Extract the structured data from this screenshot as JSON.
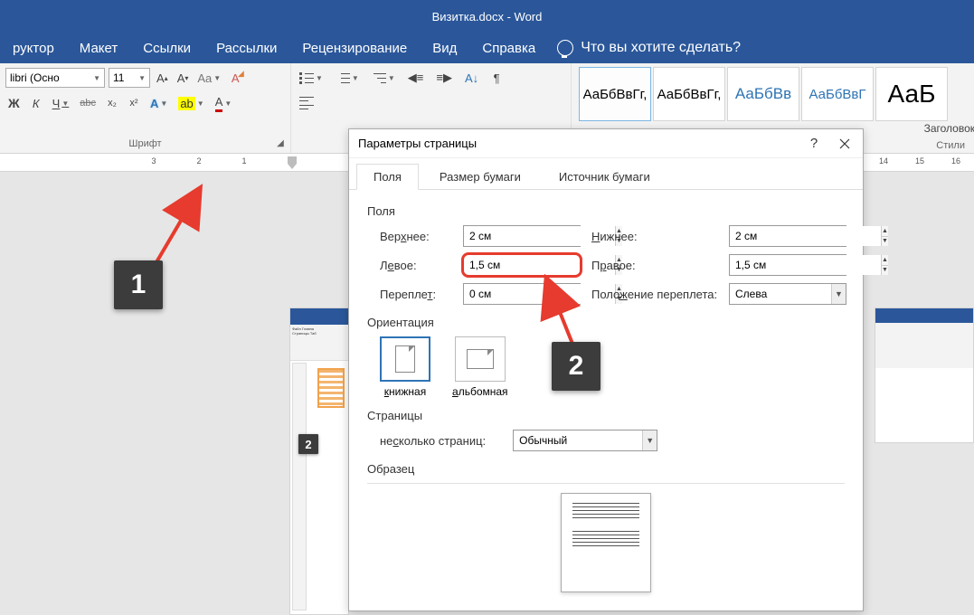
{
  "title": "Визитка.docx  -  Word",
  "tabs": [
    "руктор",
    "Макет",
    "Ссылки",
    "Рассылки",
    "Рецензирование",
    "Вид",
    "Справка"
  ],
  "tellMe": "Что вы хотите сделать?",
  "font": {
    "family": "libri (Осно",
    "size": "11"
  },
  "groupLabels": {
    "font": "Шрифт",
    "styles": "Стили"
  },
  "fontButtons": {
    "bold": "Ж",
    "italic": "К",
    "underline": "Ч",
    "strike": "abc",
    "sub": "x₂",
    "sup": "x²"
  },
  "styles": {
    "s1": "АаБбВвГг,",
    "s2": "АаБбВвГг,",
    "s3": "АаБбВв",
    "s4": "АаБбВвГ",
    "s5": "АаБ",
    "cap": "Заголовок"
  },
  "rulerNums": [
    "3",
    "2",
    "1"
  ],
  "rulerRight": [
    "14",
    "15",
    "16"
  ],
  "dialog": {
    "title": "Параметры страницы",
    "tabs": {
      "fields": "Поля",
      "paper": "Размер бумаги",
      "source": "Источник бумаги"
    },
    "sections": {
      "fields": "Поля",
      "orientation": "Ориентация",
      "pages": "Страницы",
      "sample": "Образец"
    },
    "labels": {
      "top": "Верхнее:",
      "bottom": "Нижнее:",
      "left": "Левое:",
      "right": "Правое:",
      "gutter": "Переплет:",
      "gutterPos": "Положение переплета:",
      "portrait": "книжная",
      "landscape": "альбомная",
      "multipage": "несколько страниц:"
    },
    "values": {
      "top": "2 см",
      "bottom": "2 см",
      "left": "1,5 см",
      "right": "1,5 см",
      "gutter": "0 см",
      "gutterPos": "Слева",
      "multipage": "Обычный"
    }
  },
  "markers": {
    "one": "1",
    "two": "2"
  }
}
